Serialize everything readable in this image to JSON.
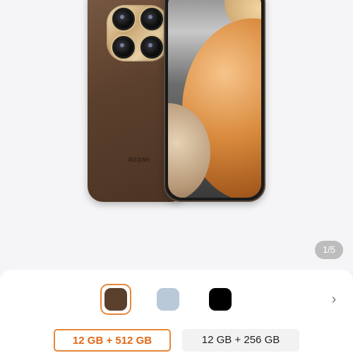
{
  "gallery": {
    "brand_text": "REDMI",
    "page_indicator": "1/5"
  },
  "colors": {
    "accent": "#e8883a",
    "swatches": [
      {
        "name": "brown",
        "hex": "#5a3f2c",
        "selected": true
      },
      {
        "name": "blue",
        "hex": "#b9c9d8",
        "selected": false
      },
      {
        "name": "black",
        "hex": "#000000",
        "selected": false
      }
    ]
  },
  "storage_options": [
    {
      "label": "12 GB + 512 GB",
      "selected": true
    },
    {
      "label": "12 GB + 256 GB",
      "selected": false
    }
  ],
  "icons": {
    "next": "chevron-right-icon"
  }
}
